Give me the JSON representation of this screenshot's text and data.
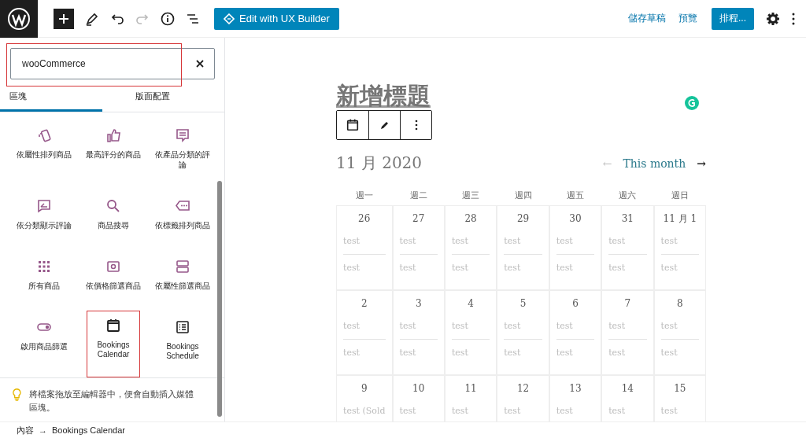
{
  "toolbar": {
    "ux_builder_button": "Edit with UX Builder",
    "save_draft": "儲存草稿",
    "preview": "預覽",
    "schedule_button": "排程..."
  },
  "inserter": {
    "search": {
      "value": "wooCommerce",
      "highlighted": true
    },
    "tabs": [
      {
        "label": "區塊",
        "selected": true
      },
      {
        "label": "版面配置",
        "selected": false
      }
    ],
    "blocks": [
      {
        "label": "依屬性排列商品",
        "highlighted": false
      },
      {
        "label": "最高評分的商品",
        "highlighted": false
      },
      {
        "label": "依產品分類的評論",
        "highlighted": false
      },
      {
        "label": "依分類顯示評論",
        "highlighted": false
      },
      {
        "label": "商品搜尋",
        "highlighted": false
      },
      {
        "label": "依標籤排列商品",
        "highlighted": false
      },
      {
        "label": "所有商品",
        "highlighted": false
      },
      {
        "label": "依價格篩選商品",
        "highlighted": false
      },
      {
        "label": "依屬性篩選商品",
        "highlighted": false
      },
      {
        "label": "啟用商品篩選",
        "highlighted": false
      },
      {
        "label": "Bookings Calendar",
        "highlighted": true
      },
      {
        "label": "Bookings Schedule",
        "highlighted": false
      }
    ],
    "tip": "將檔案拖放至編輯器中，便會自動插入媒體區塊。"
  },
  "editor": {
    "title_placeholder": "新增標題",
    "calendar": {
      "month": "11 月 2020",
      "prev": "←",
      "this_month": "This month",
      "next": "→",
      "weekdays": [
        "週一",
        "週二",
        "週三",
        "週四",
        "週五",
        "週六",
        "週日"
      ],
      "weeks": [
        [
          {
            "date": "26",
            "events": [
              "test",
              "test"
            ]
          },
          {
            "date": "27",
            "events": [
              "test",
              "test"
            ]
          },
          {
            "date": "28",
            "events": [
              "test",
              "test"
            ]
          },
          {
            "date": "29",
            "events": [
              "test",
              "test"
            ]
          },
          {
            "date": "30",
            "events": [
              "test",
              "test"
            ]
          },
          {
            "date": "31",
            "events": [
              "test",
              "test"
            ]
          },
          {
            "date": "11 月 1",
            "events": [
              "test",
              "test"
            ]
          }
        ],
        [
          {
            "date": "2",
            "events": [
              "test",
              "test"
            ]
          },
          {
            "date": "3",
            "events": [
              "test",
              "test"
            ]
          },
          {
            "date": "4",
            "events": [
              "test",
              "test"
            ]
          },
          {
            "date": "5",
            "events": [
              "test",
              "test"
            ]
          },
          {
            "date": "6",
            "events": [
              "test",
              "test"
            ]
          },
          {
            "date": "7",
            "events": [
              "test",
              "test"
            ]
          },
          {
            "date": "8",
            "events": [
              "test",
              "test"
            ]
          }
        ],
        [
          {
            "date": "9",
            "events": [
              "test (Sold"
            ]
          },
          {
            "date": "10",
            "events": [
              "test"
            ]
          },
          {
            "date": "11",
            "events": [
              "test"
            ]
          },
          {
            "date": "12",
            "events": [
              "test"
            ]
          },
          {
            "date": "13",
            "events": [
              "test"
            ]
          },
          {
            "date": "14",
            "events": [
              "test"
            ]
          },
          {
            "date": "15",
            "events": [
              "test"
            ]
          }
        ]
      ]
    }
  },
  "breadcrumb": [
    "內容",
    "→",
    "Bookings Calendar"
  ]
}
